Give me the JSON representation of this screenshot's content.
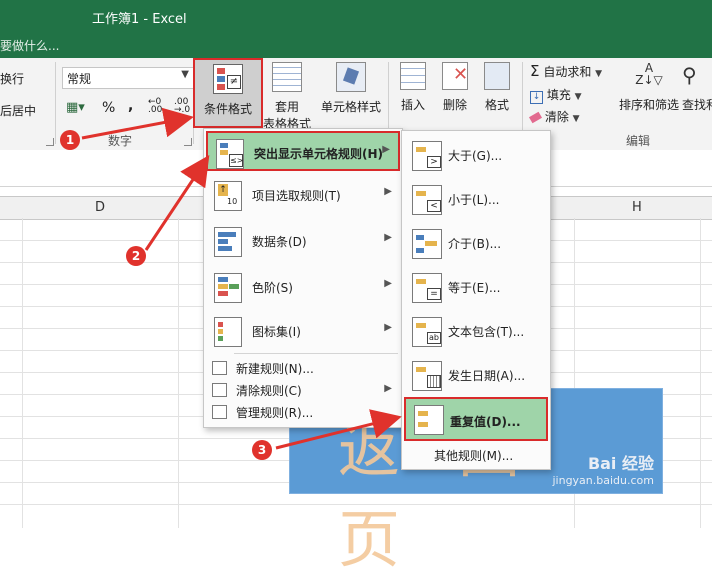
{
  "window": {
    "title": "工作簿1 - Excel",
    "tell_me": "要做什么..."
  },
  "ribbon": {
    "wrap_text": "换行",
    "merge_center": "后居中",
    "number_format": "常规",
    "percent": "%",
    "comma": ",",
    "number_group": "数字",
    "conditional_formatting": "条件格式",
    "format_as_table_1": "套用",
    "format_as_table_2": "表格格式",
    "cell_styles": "单元格样式",
    "insert": "插入",
    "delete": "删除",
    "format": "格式",
    "autosum": "自动求和",
    "fill": "填充",
    "clear": "清除",
    "editing_group": "编辑",
    "sort_filter": "排序和筛选",
    "find_select": "查找和"
  },
  "columns": [
    "D",
    "H"
  ],
  "menu1": {
    "items": [
      {
        "label": "突出显示单元格规则(H)"
      },
      {
        "label": "项目选取规则(T)"
      },
      {
        "label": "数据条(D)"
      },
      {
        "label": "色阶(S)"
      },
      {
        "label": "图标集(I)"
      }
    ],
    "small_items": [
      {
        "label": "新建规则(N)..."
      },
      {
        "label": "清除规则(C)"
      },
      {
        "label": "管理规则(R)..."
      }
    ]
  },
  "menu2": {
    "items": [
      {
        "label": "大于(G)..."
      },
      {
        "label": "小于(L)..."
      },
      {
        "label": "介于(B)..."
      },
      {
        "label": "等于(E)..."
      },
      {
        "label": "文本包含(T)..."
      },
      {
        "label": "发生日期(A)..."
      },
      {
        "label": "重复值(D)..."
      }
    ],
    "other_rules": "其他规则(M)..."
  },
  "callouts": [
    "1",
    "2",
    "3"
  ],
  "overlay": {
    "text": "返回页",
    "watermark_top": "Bai 经验",
    "watermark_bottom": "jingyan.baidu.com"
  },
  "colors": {
    "excel_green": "#217346",
    "highlight_red": "#d92b2b",
    "menu_highlight": "#9fd4a9",
    "overlay_blue": "#5b9bd5"
  }
}
